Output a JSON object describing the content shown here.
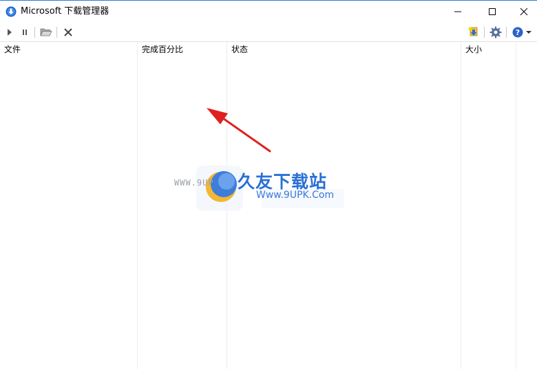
{
  "window": {
    "title": "Microsoft 下载管理器",
    "accent": "#2b7bd4"
  },
  "toolbar": {
    "icons": [
      "play-icon",
      "pause-icon",
      "folder-open-icon",
      "delete-icon",
      "download-add-icon",
      "gear-icon",
      "help-icon",
      "dropdown-arrow-icon"
    ]
  },
  "columns": [
    {
      "label": "文件"
    },
    {
      "label": "完成百分比"
    },
    {
      "label": "状态"
    },
    {
      "label": "大小"
    }
  ],
  "watermark": {
    "www": "WWW.9UP",
    "cn": "久友下载站",
    "url": "Www.9UPK.Com",
    "color": "#2a6fd6"
  },
  "annotation": {
    "arrow_color": "#e02020"
  }
}
